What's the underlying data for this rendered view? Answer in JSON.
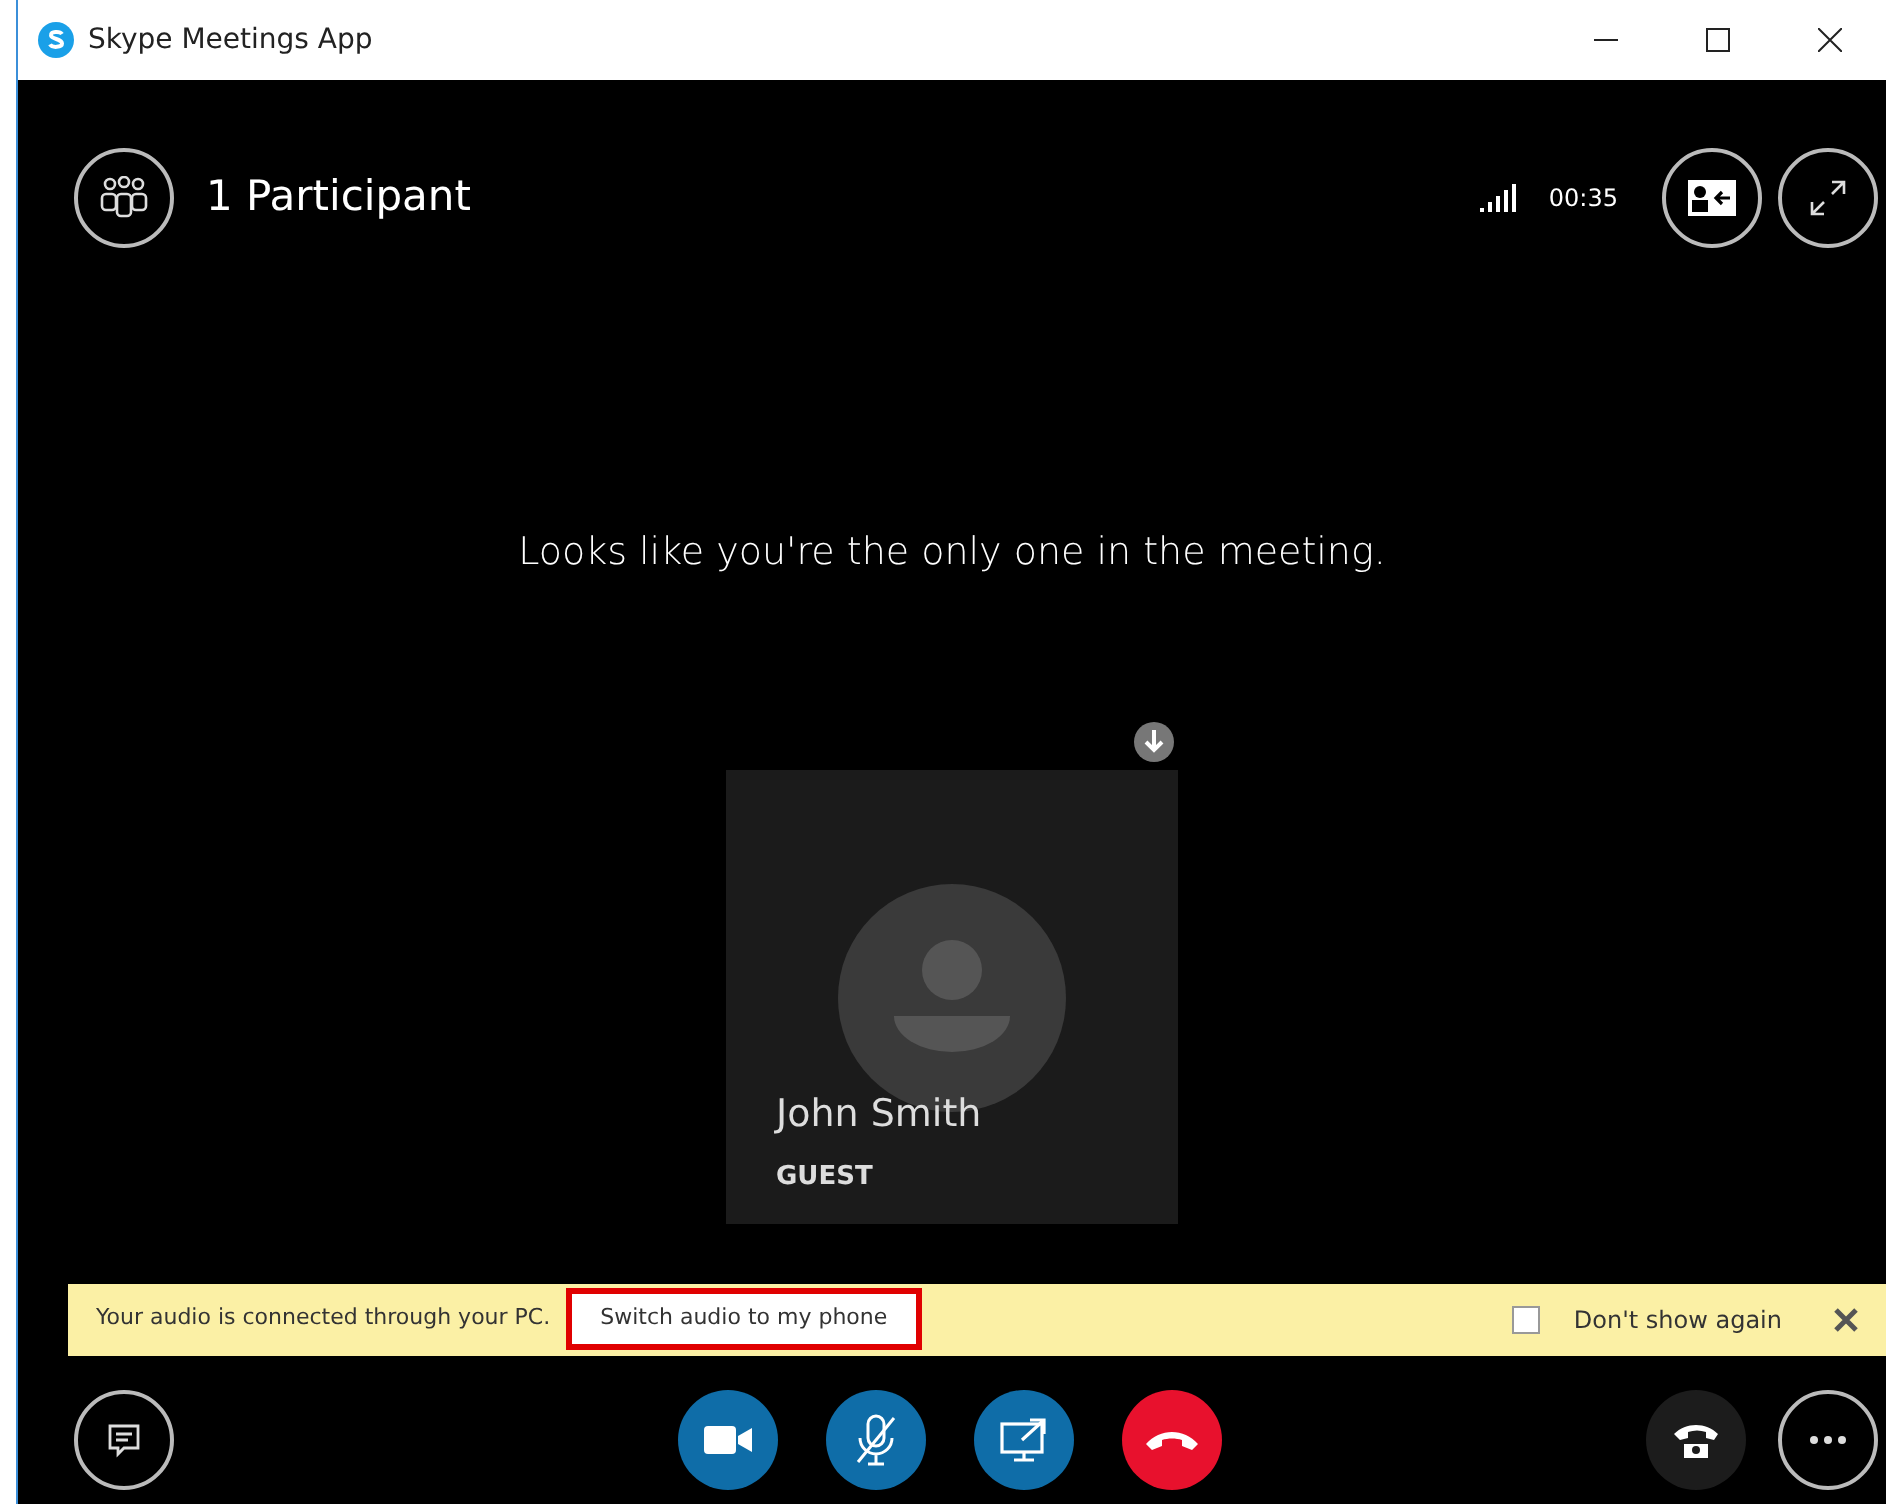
{
  "window": {
    "title": "Skype Meetings App"
  },
  "header": {
    "participants": "1 Participant",
    "timer": "00:35"
  },
  "message": "Looks like you're the only one in the meeting.",
  "participant": {
    "name": "John Smith",
    "role": "GUEST"
  },
  "banner": {
    "text": "Your audio is connected through your PC.",
    "button": {
      "label": "Switch audio to my phone",
      "highlighted": true
    },
    "checkbox": {
      "label": "Don't show again",
      "checked": false
    }
  },
  "call_controls": [
    {
      "kind": "video"
    },
    {
      "kind": "mic",
      "muted": true
    },
    {
      "kind": "share"
    },
    {
      "kind": "hangup"
    }
  ]
}
